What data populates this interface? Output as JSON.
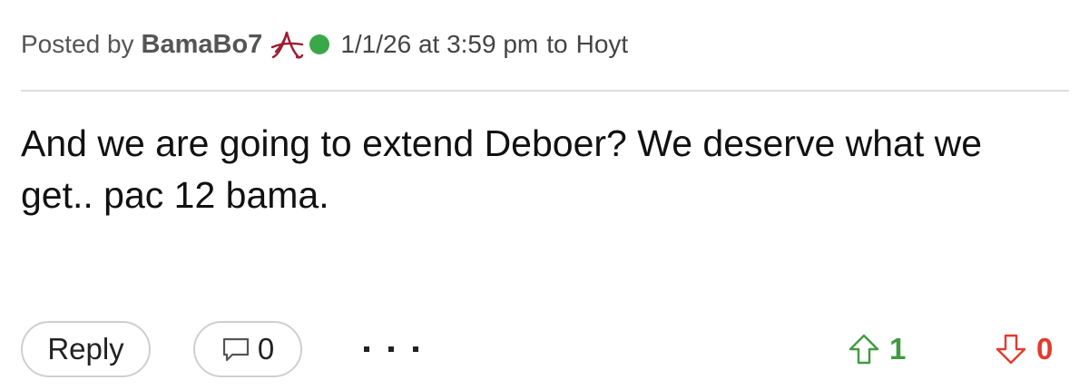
{
  "post": {
    "posted_by_label": "Posted by",
    "username": "BamaBo7",
    "team_icon": "alabama-script-a-icon",
    "online_status_color": "#3aa84a",
    "timestamp": "1/1/26 at 3:59 pm",
    "to_label": "to",
    "recipient": "Hoyt",
    "body": "And we are going to extend Deboer? We deserve what we get.. pac 12 bama."
  },
  "actions": {
    "reply_label": "Reply",
    "comment_icon": "comment-bubble-icon",
    "comment_count": "0",
    "more_icon": "more-dots-icon",
    "upvote_icon": "upvote-arrow-icon",
    "upvote_count": "1",
    "upvote_color": "#3f9a3f",
    "downvote_icon": "downvote-arrow-icon",
    "downvote_count": "0",
    "downvote_color": "#e23b2e"
  },
  "colors": {
    "team_crimson": "#9e1b32"
  }
}
